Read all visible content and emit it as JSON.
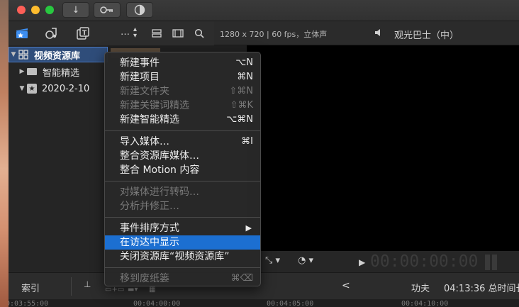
{
  "toolbar": {
    "import_icon": "↓",
    "key_icon": "key-icon",
    "halfcircle_icon": "half-circle-icon"
  },
  "browser_bar": {
    "more": "…",
    "format": "1280 x 720 | 60 fps，立体声",
    "viewer_title": "观光巴士（中）"
  },
  "sidebar": {
    "library": "视频资源库",
    "smart_collections": "智能精选",
    "event": "2020-2-10"
  },
  "menu": {
    "items": [
      {
        "label": "新建事件",
        "shortcut": "⌥N",
        "enabled": true
      },
      {
        "label": "新建项目",
        "shortcut": "⌘N",
        "enabled": true
      },
      {
        "label": "新建文件夹",
        "shortcut": "⇧⌘N",
        "enabled": false
      },
      {
        "label": "新建关键词精选",
        "shortcut": "⇧⌘K",
        "enabled": false
      },
      {
        "label": "新建智能精选",
        "shortcut": "⌥⌘N",
        "enabled": true
      },
      {
        "label": "导入媒体…",
        "shortcut": "⌘I",
        "enabled": true
      },
      {
        "label": "整合资源库媒体…",
        "shortcut": "",
        "enabled": true
      },
      {
        "label": "整合 Motion 内容",
        "shortcut": "",
        "enabled": true
      },
      {
        "label": "对媒体进行转码…",
        "shortcut": "",
        "enabled": false
      },
      {
        "label": "分析并修正…",
        "shortcut": "",
        "enabled": false
      },
      {
        "label": "事件排序方式",
        "shortcut": "▶",
        "enabled": true
      },
      {
        "label": "在访达中显示",
        "shortcut": "",
        "enabled": true,
        "selected": true
      },
      {
        "label": "关闭资源库“视频资源库”",
        "shortcut": "",
        "enabled": true
      },
      {
        "label": "移到废纸篓",
        "shortcut": "⌘⌫",
        "enabled": false
      }
    ]
  },
  "viewer": {
    "timecode": "00:00:00:00"
  },
  "timeline_bar": {
    "index": "索引",
    "back": "<",
    "project": "功夫",
    "total": "04:13:36 总时间长"
  },
  "ruler": {
    "t0": "0:03:55:00",
    "t1": "00:04:00:00",
    "t2": "00:04:05:00",
    "t3": "00:04:10:00"
  }
}
